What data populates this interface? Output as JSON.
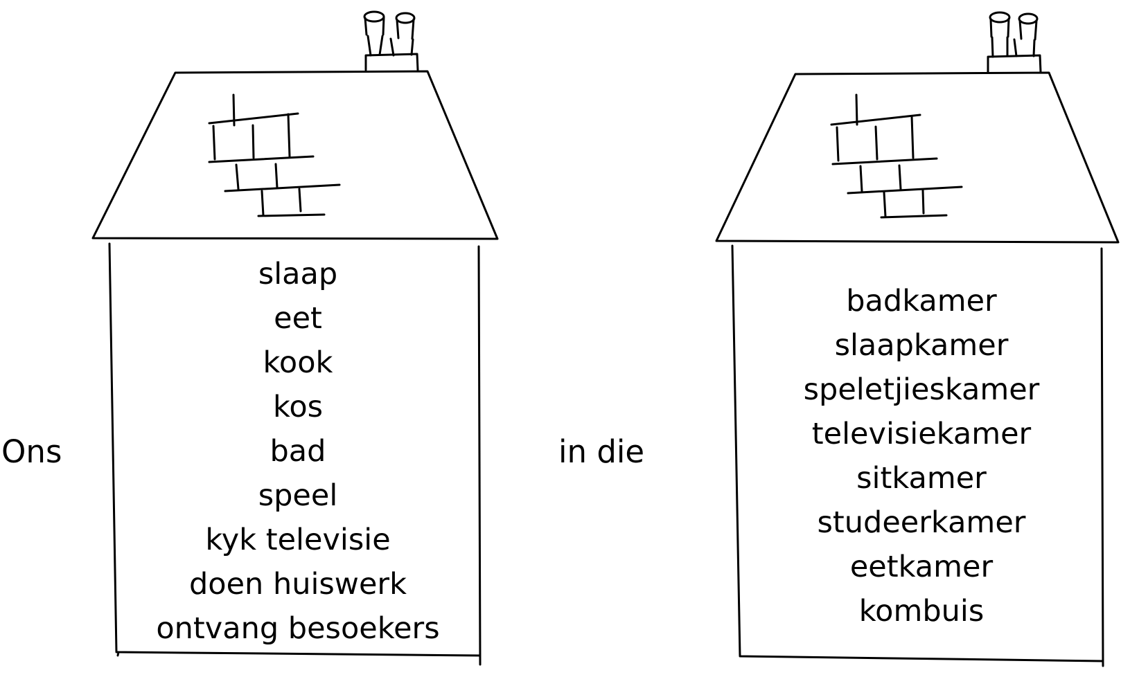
{
  "prefix_label": "Ons",
  "connector_label": "in die",
  "left_house": {
    "words": [
      "slaap",
      "eet",
      "kook",
      "kos",
      "bad",
      "speel",
      "kyk televisie",
      "doen huiswerk",
      "ontvang besoekers"
    ]
  },
  "right_house": {
    "words": [
      "badkamer",
      "slaapkamer",
      "speletjieskamer",
      "televisiekamer",
      "sitkamer",
      "studeerkamer",
      "eetkamer",
      "kombuis"
    ]
  },
  "colors": {
    "ink": "#000000",
    "background": "#ffffff"
  }
}
